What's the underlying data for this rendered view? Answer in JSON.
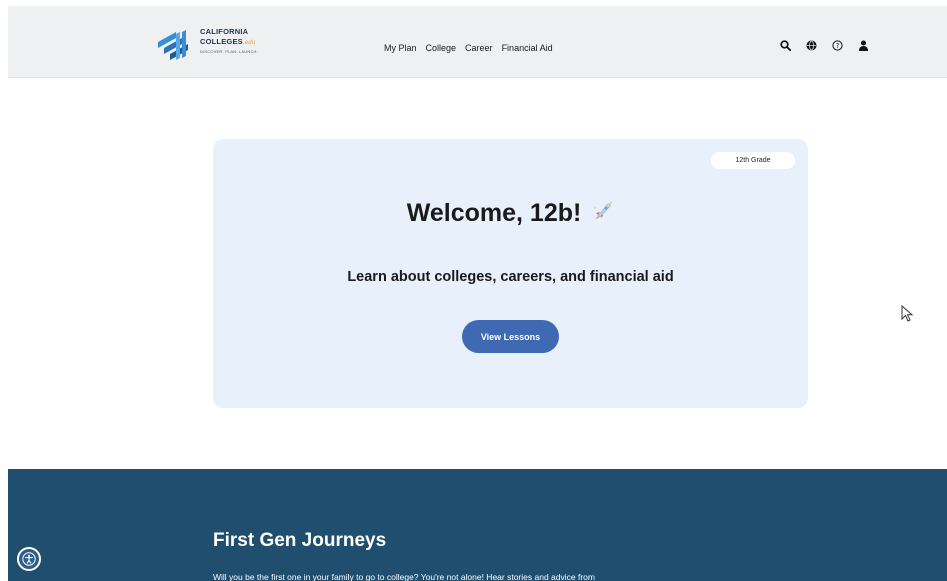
{
  "header": {
    "logo": {
      "line1": "CALIFORNIA",
      "line2": "COLLEGES",
      "suffix": ".edu",
      "tagline": "DISCOVER. PLAN. LAUNCH."
    },
    "nav": [
      "My Plan",
      "College",
      "Career",
      "Financial Aid"
    ],
    "tools": [
      "search-icon",
      "language-icon",
      "help-icon",
      "user-icon"
    ]
  },
  "welcome_card": {
    "grade_badge": "12th Grade",
    "title": "Welcome, 12b!",
    "subtitle": "Learn about colleges, careers, and financial aid",
    "button": "View Lessons"
  },
  "journeys": {
    "title": "First Gen Journeys",
    "text": "Will you be the first one in your family to go to college? You're not alone! Hear stories and advice from"
  },
  "colors": {
    "brand_blue": "#3f69b3",
    "card_bg": "#e8f1fb",
    "section_bg": "#1f4e6e",
    "header_bg": "#eef0f1"
  }
}
